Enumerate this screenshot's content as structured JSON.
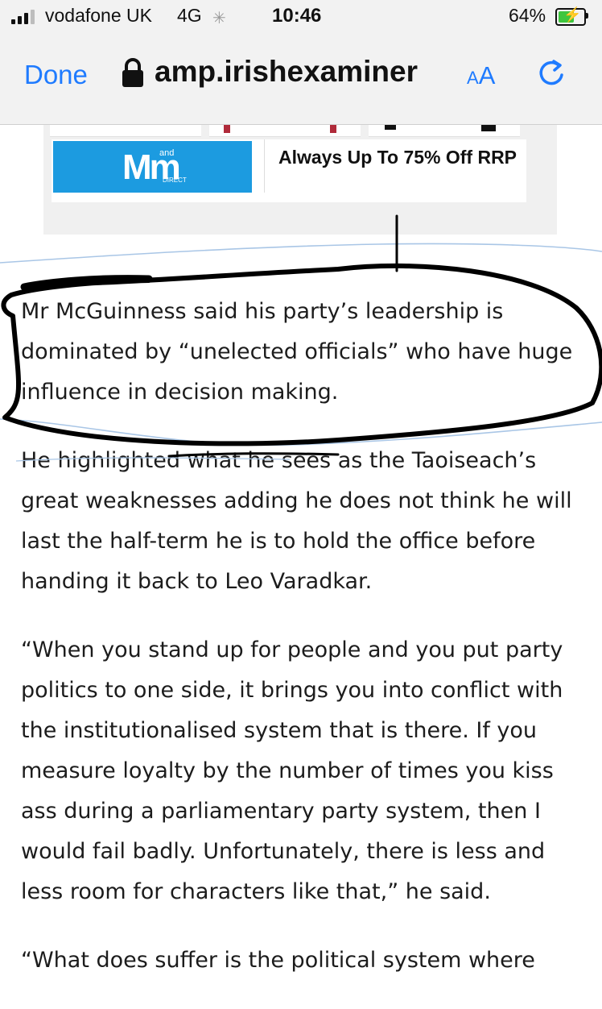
{
  "status_bar": {
    "carrier": "vodafone UK",
    "network": "4G",
    "time": "10:46",
    "battery_percent": "64%",
    "battery_level": 0.64
  },
  "browser": {
    "done_label": "Done",
    "url": "amp.irishexaminer",
    "text_size_small": "A",
    "text_size_large": "A"
  },
  "ad": {
    "logo_main": "Mm",
    "logo_and": "and",
    "logo_direct": "DIRECT",
    "tagline": "Always Up To 75% Off RRP"
  },
  "article": {
    "paragraphs": [
      "Mr McGuinness said his party’s leadership is dominated by “unelected officials” who have huge influence in decision making.",
      "He highlighted what he sees as the Taoiseach’s great weaknesses adding he does not think he will last the half-term he is to hold the office before handing it back to Leo Varadkar.",
      "“When you stand up for people and you put party politics to one side, it brings you into conflict with the institutionalised system that is there. If you measure loyalty by the number of times you kiss ass during a parliamentary party system, then I would fail badly. Unfortunately, there is less and less room for characters like that,” he said.",
      "“What does suffer is the political system where"
    ]
  },
  "colors": {
    "accent": "#1f7bff",
    "ad_blue": "#1c9be0",
    "battery_green": "#3ec63e",
    "annotation_ink": "#000000",
    "annotation_blue": "#a9c6e6"
  }
}
